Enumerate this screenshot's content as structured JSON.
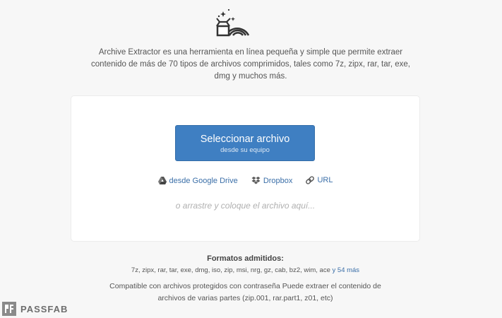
{
  "intro": {
    "line1": "Archive Extractor es una herramienta en línea pequeña y simple que permite extraer",
    "line2": "contenido de más de 70 tipos de archivos comprimidos, tales como 7z, zipx, rar, tar, exe,",
    "line3": "dmg y muchos más."
  },
  "upload": {
    "select_label": "Seleccionar archivo",
    "select_sub": "desde su equipo",
    "sources": [
      {
        "label": "desde Google Drive",
        "icon": "google-drive-icon"
      },
      {
        "label": "Dropbox",
        "icon": "dropbox-icon"
      },
      {
        "label": "URL",
        "icon": "link-icon"
      }
    ],
    "drop_hint": "o arrastre y coloque el archivo aquí..."
  },
  "formats": {
    "title": "Formatos admitidos:",
    "list": "7z, zipx, rar, tar, exe, dmg, iso, zip, msi, nrg, gz, cab, bz2, wim, ace",
    "more_link": "y 54 más"
  },
  "compat": {
    "line1": "Compatible con archivos protegidos con contraseña Puede extraer el contenido de",
    "line2": "archivos de varias partes (zip.001, rar.part1, z01, etc)"
  },
  "watermark": {
    "text": "PASSFAB"
  },
  "colors": {
    "accent": "#3f7fc2",
    "link": "#3b6fa8",
    "background": "#f7f7f7"
  }
}
